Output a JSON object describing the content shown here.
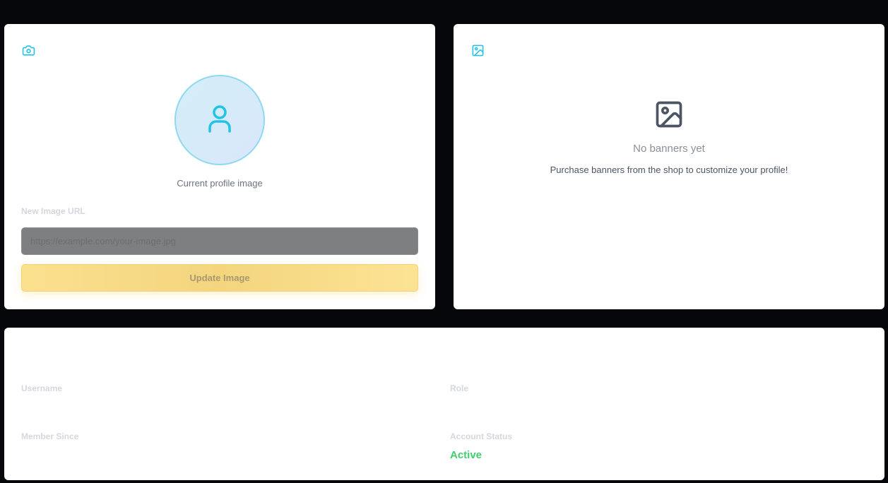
{
  "profile_image": {
    "caption": "Current profile image",
    "url_label": "New Image URL",
    "url_placeholder": "https://example.com/your-image.jpg",
    "url_value": "",
    "update_button": "Update Image"
  },
  "banners": {
    "empty_title": "No banners yet",
    "empty_subtitle": "Purchase banners from the shop to customize your profile!"
  },
  "account_info": {
    "username_label": "Username",
    "role_label": "Role",
    "member_since_label": "Member Since",
    "status_label": "Account Status",
    "status_value": "Active"
  },
  "colors": {
    "accent_cyan": "#22c3e6",
    "status_active": "#3ecf6e",
    "button_yellow": "#f7d982"
  },
  "icons": {
    "avatar_card": "camera-icon",
    "banner_card": "image-icon",
    "avatar_placeholder": "user-icon",
    "banner_empty": "image-icon"
  }
}
